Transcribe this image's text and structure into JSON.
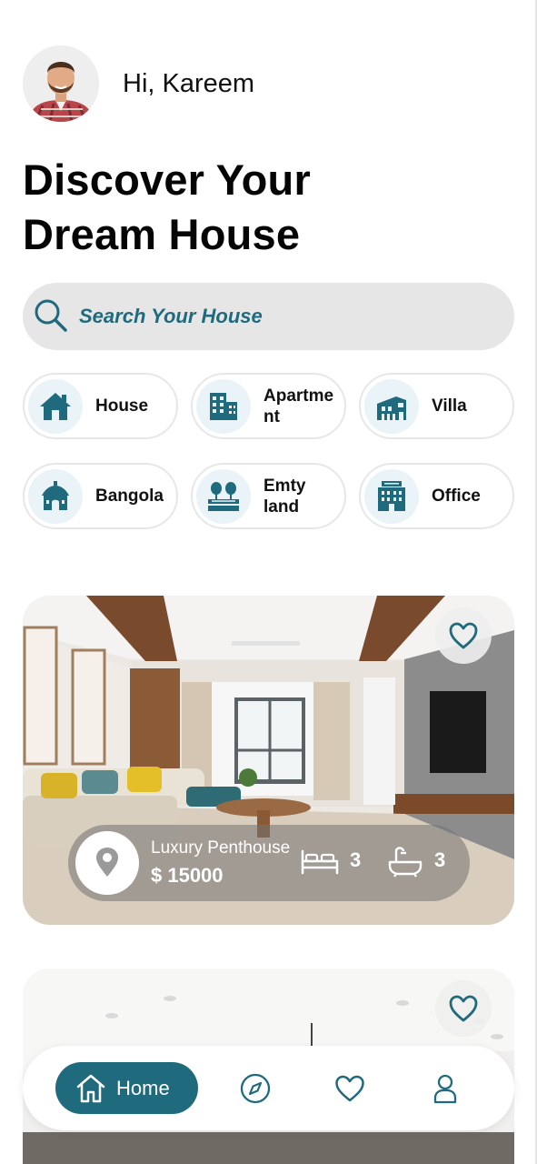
{
  "user": {
    "greeting": "Hi, Kareem"
  },
  "headline": {
    "line1": "Discover Your",
    "line2": "Dream House"
  },
  "search": {
    "placeholder": "Search Your House"
  },
  "categories": [
    {
      "label": "House",
      "icon": "house-icon"
    },
    {
      "label": "Apartme nt",
      "icon": "apartment-icon"
    },
    {
      "label": "Villa",
      "icon": "villa-icon"
    },
    {
      "label": "Bangola",
      "icon": "bungalow-icon"
    },
    {
      "label": "Emty land",
      "icon": "land-icon"
    },
    {
      "label": "Office",
      "icon": "office-icon"
    }
  ],
  "listings": [
    {
      "name": "Luxury Penthouse",
      "price": "$ 15000",
      "beds": "3",
      "baths": "3"
    }
  ],
  "nav": {
    "home_label": "Home"
  },
  "colors": {
    "accent": "#1f6b7d",
    "chip_bg": "#eaf3f7",
    "search_bg": "#e6e6e6"
  }
}
